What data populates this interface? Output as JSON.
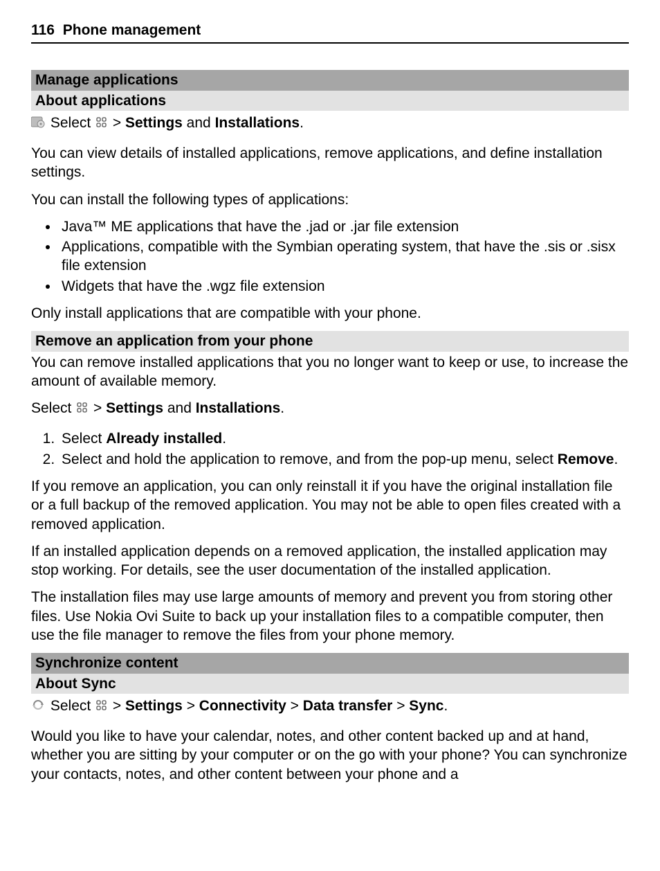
{
  "page": {
    "number": "116",
    "title": "Phone management"
  },
  "sec1": {
    "heading": "Manage applications",
    "sub": "About applications",
    "select_prefix": "Select ",
    "select_mid": " > ",
    "settings": "Settings",
    "and": " and ",
    "installations": "Installations",
    "period": ".",
    "p1": "You can view details of installed applications, remove applications, and define installation settings.",
    "p2": "You can install the following types of applications:",
    "li1": "Java™ ME applications that have the .jad or .jar file extension",
    "li2": "Applications, compatible with the Symbian operating system, that have the .sis or .sisx file extension",
    "li3": "Widgets that have the .wgz file extension",
    "p3": "Only install applications that are compatible with your phone."
  },
  "sec2": {
    "heading": "Remove an application from your phone",
    "p1": "You can remove installed applications that you no longer want to keep or use, to increase the amount of available memory.",
    "select_prefix": "Select ",
    "select_mid": " > ",
    "settings": "Settings",
    "and": " and ",
    "installations": "Installations",
    "period": ".",
    "step1_pre": "Select ",
    "step1_bold": "Already installed",
    "step1_post": ".",
    "step2_pre": "Select and hold the application to remove, and from the pop-up menu, select ",
    "step2_bold": "Remove",
    "step2_post": ".",
    "p2": "If you remove an application, you can only reinstall it if you have the original installation file or a full backup of the removed application. You may not be able to open files created with a removed application.",
    "p3": "If an installed application depends on a removed application, the installed application may stop working. For details, see the user documentation of the installed application.",
    "p4": "The installation files may use large amounts of memory and prevent you from storing other files. Use Nokia Ovi Suite to back up your installation files to a compatible computer, then use the file manager to remove the files from your phone memory."
  },
  "sec3": {
    "heading": "Synchronize content",
    "sub": "About Sync",
    "select_prefix": "Select ",
    "gt": " > ",
    "settings": "Settings",
    "connectivity": "Connectivity",
    "datatransfer": "Data transfer",
    "sync": "Sync",
    "period": ".",
    "p1": "Would you like to have your calendar, notes, and other content backed up and at hand, whether you are sitting by your computer or on the go with your phone? You can synchronize your contacts, notes, and other content between your phone and a"
  }
}
